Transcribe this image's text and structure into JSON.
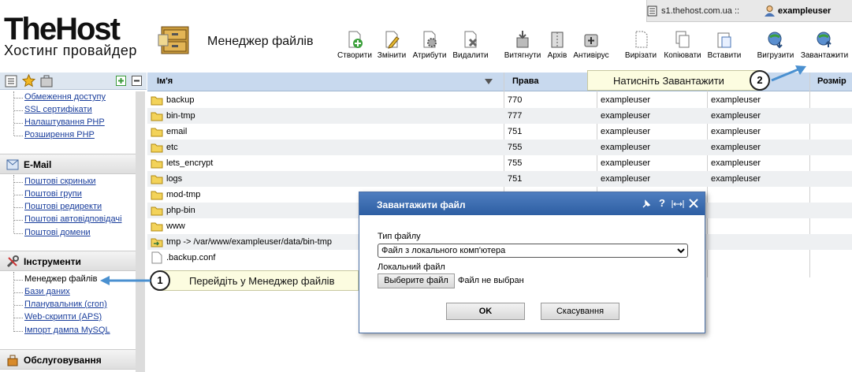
{
  "topbar": {
    "server_text": "s1.thehost.com.ua ::",
    "username": "exampleuser"
  },
  "logo": {
    "title": "TheHost",
    "subtitle": "Хостинг провайдер"
  },
  "page_title": "Менеджер файлів",
  "toolbar": [
    {
      "label": "Створити",
      "icon": "create-icon"
    },
    {
      "label": "Змінити",
      "icon": "edit-icon"
    },
    {
      "label": "Атрибути",
      "icon": "attributes-icon"
    },
    {
      "label": "Видалити",
      "icon": "delete-icon"
    },
    {
      "label": "Витягнути",
      "icon": "extract-icon"
    },
    {
      "label": "Архів",
      "icon": "archive-icon"
    },
    {
      "label": "Антивірус",
      "icon": "antivirus-icon"
    },
    {
      "label": "Вирізати",
      "icon": "cut-icon"
    },
    {
      "label": "Копіювати",
      "icon": "copy-icon"
    },
    {
      "label": "Вставити",
      "icon": "paste-icon"
    },
    {
      "label": "Вигрузити",
      "icon": "download-icon"
    },
    {
      "label": "Завантажити",
      "icon": "upload-icon"
    }
  ],
  "sidebar": {
    "top_links": [
      "Обмеження доступу",
      "SSL сертифікати",
      "Налаштування PHP",
      "Розширення PHP"
    ],
    "email": {
      "title": "E-Mail",
      "links": [
        "Поштові скриньки",
        "Поштові групи",
        "Поштові редиректи",
        "Поштові автовідповідачі",
        "Поштові домени"
      ]
    },
    "tools": {
      "title": "Інструменти",
      "links": [
        "Менеджер файлів",
        "Бази даних",
        "Планувальник (cron)",
        "Web-скрипти (APS)",
        "Імпорт дампа MySQL"
      ]
    },
    "service": {
      "title": "Обслуговування"
    }
  },
  "table": {
    "headers": {
      "name": "Ім'я",
      "rights": "Права",
      "size": "Розмір"
    },
    "rows": [
      {
        "name": "backup",
        "rights": "770",
        "owner": "exampleuser",
        "group": "exampleuser",
        "type": "folder"
      },
      {
        "name": "bin-tmp",
        "rights": "777",
        "owner": "exampleuser",
        "group": "exampleuser",
        "type": "folder"
      },
      {
        "name": "email",
        "rights": "751",
        "owner": "exampleuser",
        "group": "exampleuser",
        "type": "folder"
      },
      {
        "name": "etc",
        "rights": "755",
        "owner": "exampleuser",
        "group": "exampleuser",
        "type": "folder"
      },
      {
        "name": "lets_encrypt",
        "rights": "755",
        "owner": "exampleuser",
        "group": "exampleuser",
        "type": "folder"
      },
      {
        "name": "logs",
        "rights": "751",
        "owner": "exampleuser",
        "group": "exampleuser",
        "type": "folder"
      },
      {
        "name": "mod-tmp",
        "rights": "",
        "owner": "",
        "group": "",
        "type": "folder"
      },
      {
        "name": "php-bin",
        "rights": "",
        "owner": "",
        "group": "",
        "type": "folder"
      },
      {
        "name": "www",
        "rights": "",
        "owner": "",
        "group": "",
        "type": "folder"
      },
      {
        "name": "tmp -> /var/www/exampleuser/data/bin-tmp",
        "rights": "",
        "owner": "",
        "group": "",
        "type": "link"
      },
      {
        "name": ".backup.conf",
        "rights": "",
        "owner": "",
        "group": "",
        "type": "file"
      }
    ]
  },
  "callouts": {
    "one": {
      "num": "1",
      "text": "Перейдіть у Менеджер файлів"
    },
    "two": {
      "num": "2",
      "text": "Натисніть Завантажити"
    }
  },
  "dialog": {
    "title": "Завантажити файл",
    "file_type_label": "Тип файлу",
    "file_type_value": "Файл з локального комп'ютера",
    "local_file_label": "Локальний файл",
    "choose_button": "Выберите файл",
    "no_file_text": "Файл не выбран",
    "ok": "OK",
    "cancel": "Скасування"
  },
  "colors": {
    "header_blue": "#c8d9ee",
    "dialog_title": "#2d5ea3",
    "link": "#1a3e9c",
    "callout_bg": "#fcfce0"
  }
}
